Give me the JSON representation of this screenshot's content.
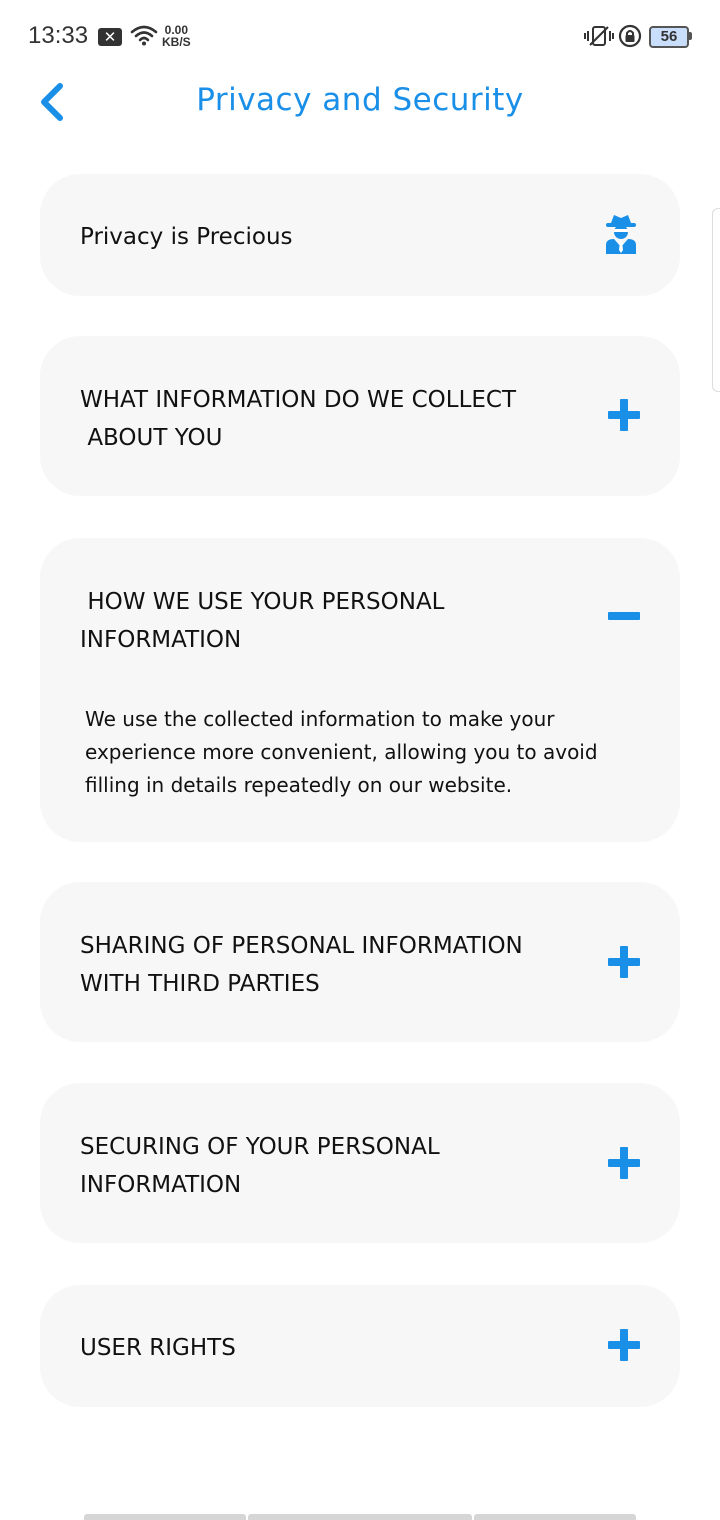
{
  "status_bar": {
    "time": "13:33",
    "notification_glyph": "✕",
    "speed_value": "0.00",
    "speed_unit": "KB/S",
    "battery": "56"
  },
  "header": {
    "title": "Privacy and Security",
    "back_icon": "chevron-left-icon"
  },
  "colors": {
    "accent": "#1a8fe8",
    "card_bg": "#f7f7f7",
    "text": "#111111"
  },
  "sections": [
    {
      "title": "Privacy is Precious",
      "icon": "spy-icon"
    },
    {
      "title": "WHAT INFORMATION DO WE COLLECT\n ABOUT YOU",
      "state": "collapsed",
      "icon": "plus-icon"
    },
    {
      "title": " HOW WE USE YOUR PERSONAL\nINFORMATION",
      "state": "expanded",
      "icon": "minus-icon",
      "body": "We use the collected information to make your experience more convenient, allowing you to avoid filling in details repeatedly on our website."
    },
    {
      "title": "SHARING OF PERSONAL INFORMATION\nWITH THIRD PARTIES",
      "state": "collapsed",
      "icon": "plus-icon"
    },
    {
      "title": "SECURING OF YOUR PERSONAL\nINFORMATION",
      "state": "collapsed",
      "icon": "plus-icon"
    },
    {
      "title": "USER RIGHTS",
      "state": "collapsed",
      "icon": "plus-icon"
    }
  ]
}
